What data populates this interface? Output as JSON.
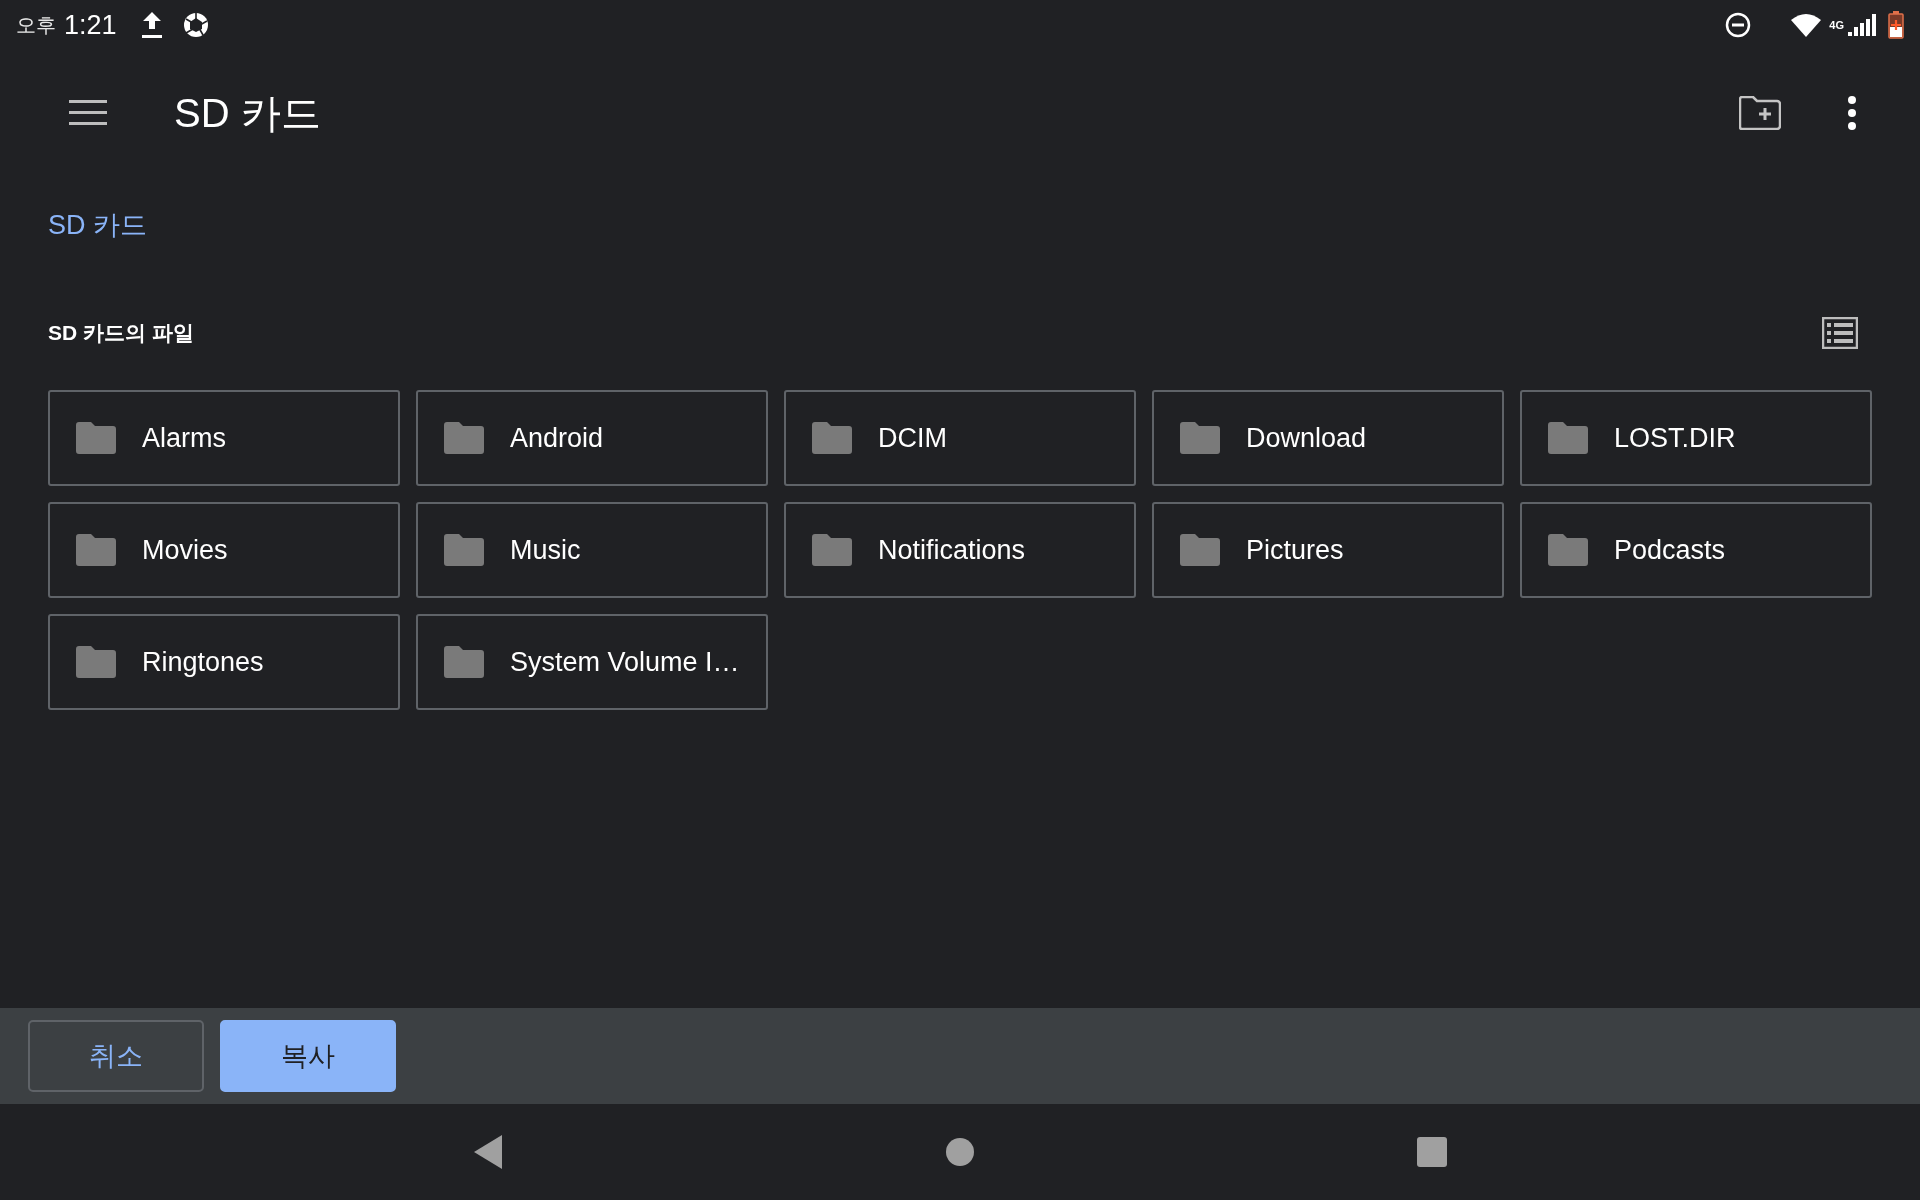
{
  "status_bar": {
    "ampm": "오후",
    "time": "1:21",
    "network": "4G"
  },
  "toolbar": {
    "title": "SD 카드"
  },
  "breadcrumb": "SD 카드",
  "section": {
    "label": "SD 카드의 파일"
  },
  "folders": [
    {
      "name": "Alarms"
    },
    {
      "name": "Android"
    },
    {
      "name": "DCIM"
    },
    {
      "name": "Download"
    },
    {
      "name": "LOST.DIR"
    },
    {
      "name": "Movies"
    },
    {
      "name": "Music"
    },
    {
      "name": "Notifications"
    },
    {
      "name": "Pictures"
    },
    {
      "name": "Podcasts"
    },
    {
      "name": "Ringtones"
    },
    {
      "name": "System Volume I…"
    }
  ],
  "actions": [
    {
      "label": "취소",
      "kind": "outlined"
    },
    {
      "label": "복사",
      "kind": "filled"
    }
  ]
}
